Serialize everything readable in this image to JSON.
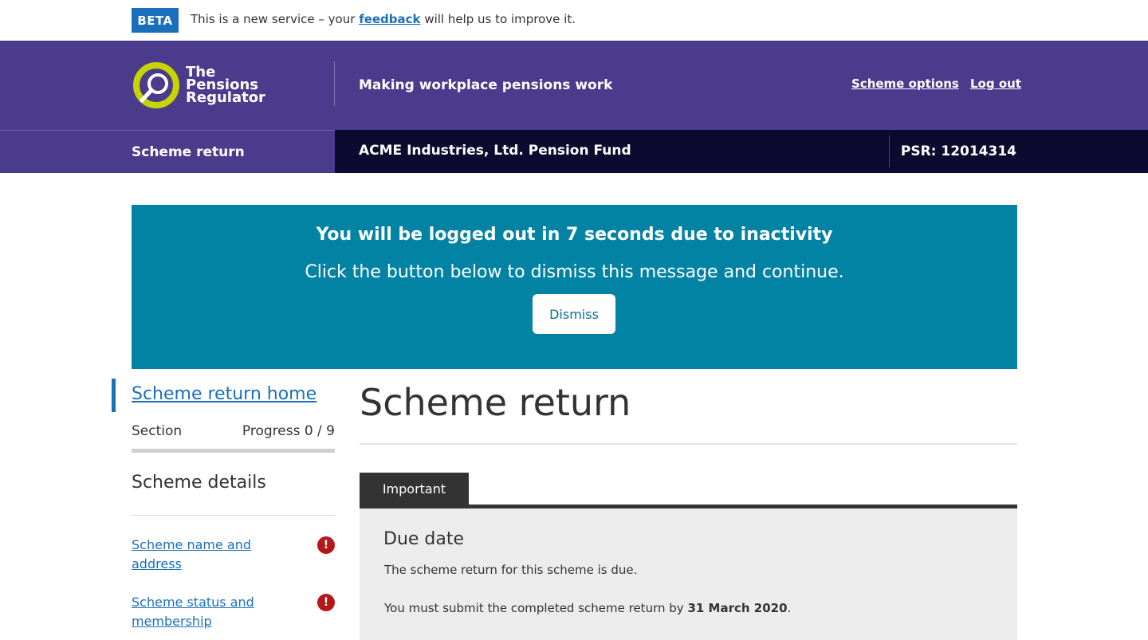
{
  "beta": {
    "tag": "BETA",
    "text_before": "This is a new service – your",
    "link": "feedback",
    "text_after": "will help us to improve it."
  },
  "header": {
    "logo_lines": [
      "The",
      "Pensions",
      "Regulator"
    ],
    "tagline": "Making workplace pensions work",
    "links": [
      "Scheme options",
      "Log out"
    ]
  },
  "subbar": {
    "service": "Scheme return",
    "scheme_name": "ACME Industries, Ltd. Pension Fund",
    "psr": "PSR: 12014314"
  },
  "timeout": {
    "title": "You will be logged out in 7 seconds due to inactivity",
    "message": "Click the button below to dismiss this message and continue.",
    "button": "Dismiss"
  },
  "sidebar": {
    "home_link": "Scheme return home",
    "section_label": "Section",
    "progress_label": "Progress 0 / 9",
    "heading": "Scheme details",
    "items": [
      {
        "label": "Scheme name and address",
        "status": "!"
      },
      {
        "label": "Scheme status and membership",
        "status": "!"
      }
    ]
  },
  "main": {
    "title": "Scheme return",
    "tab": "Important",
    "panel_title": "Due date",
    "panel_p1": "The scheme return for this scheme is due.",
    "panel_p2_before": "You must submit the completed scheme return by",
    "panel_p2_date": "31 March 2020",
    "panel_p2_after": "."
  },
  "colors": {
    "header_purple": "#4b3b8c",
    "dark_navy": "#0c0a2f",
    "banner_teal": "#0383a3",
    "link_blue": "#1a6fba",
    "logo_lime": "#c8d400",
    "error_red": "#b51818"
  }
}
